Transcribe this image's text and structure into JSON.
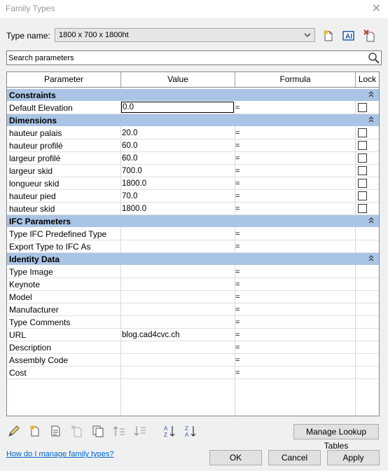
{
  "window": {
    "title": "Family Types",
    "close_glyph": "✕"
  },
  "type_name": {
    "label": "Type name:",
    "value": "1800 x 700 x 1800ht"
  },
  "search": {
    "placeholder": "Search parameters"
  },
  "table": {
    "headers": {
      "parameter": "Parameter",
      "value": "Value",
      "formula": "Formula",
      "lock": "Lock"
    },
    "sections": [
      {
        "title": "Constraints",
        "rows": [
          {
            "param": "Default Elevation",
            "value": "0.0",
            "formula": "=",
            "lock": true
          }
        ]
      },
      {
        "title": "Dimensions",
        "rows": [
          {
            "param": "hauteur palais",
            "value": "20.0",
            "formula": "=",
            "lock": true
          },
          {
            "param": "hauteur profilé",
            "value": "60.0",
            "formula": "=",
            "lock": true
          },
          {
            "param": "largeur profilé",
            "value": "60.0",
            "formula": "=",
            "lock": true
          },
          {
            "param": "largeur skid",
            "value": "700.0",
            "formula": "=",
            "lock": true
          },
          {
            "param": "longueur skid",
            "value": "1800.0",
            "formula": "=",
            "lock": true
          },
          {
            "param": "hauteur pied",
            "value": "70.0",
            "formula": "=",
            "lock": true
          },
          {
            "param": "hauteur skid",
            "value": "1800.0",
            "formula": "=",
            "lock": true
          }
        ]
      },
      {
        "title": "IFC Parameters",
        "rows": [
          {
            "param": "Type IFC Predefined Type",
            "value": "",
            "formula": "=",
            "lock": false
          },
          {
            "param": "Export Type to IFC As",
            "value": "",
            "formula": "=",
            "lock": false
          }
        ]
      },
      {
        "title": "Identity Data",
        "rows": [
          {
            "param": "Type Image",
            "value": "",
            "formula": "=",
            "lock": false
          },
          {
            "param": "Keynote",
            "value": "",
            "formula": "=",
            "lock": false
          },
          {
            "param": "Model",
            "value": "",
            "formula": "=",
            "lock": false
          },
          {
            "param": "Manufacturer",
            "value": "",
            "formula": "=",
            "lock": false
          },
          {
            "param": "Type Comments",
            "value": "",
            "formula": "=",
            "lock": false
          },
          {
            "param": "URL",
            "value": "blog.cad4cvc.ch",
            "formula": "=",
            "lock": false
          },
          {
            "param": "Description",
            "value": "",
            "formula": "=",
            "lock": false
          },
          {
            "param": "Assembly Code",
            "value": "",
            "formula": "=",
            "lock": false
          },
          {
            "param": "Cost",
            "value": "",
            "formula": "=",
            "lock": false
          }
        ]
      }
    ]
  },
  "buttons": {
    "manage_lookup": "Manage Lookup Tables",
    "ok": "OK",
    "cancel": "Cancel",
    "apply": "Apply"
  },
  "help_link": "How do I manage family types?",
  "colors": {
    "section_bg": "#a9c4e4",
    "link": "#0066cc",
    "accent_blue": "#1e5aa8",
    "accent_red": "#c0392b"
  }
}
